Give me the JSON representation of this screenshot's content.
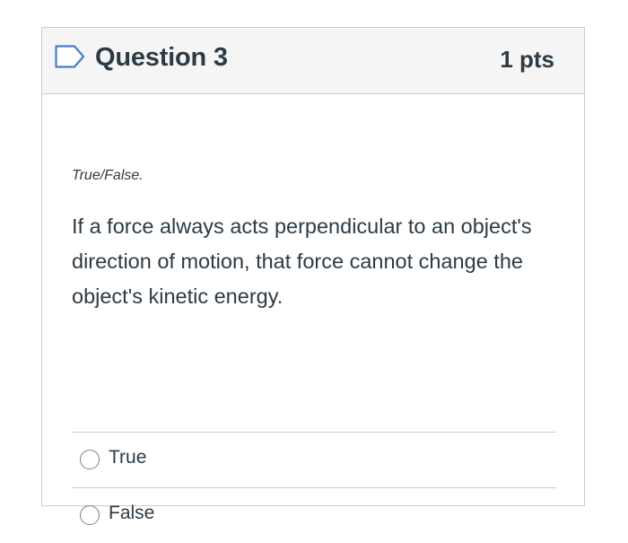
{
  "question": {
    "title": "Question 3",
    "points": "1 pts",
    "flag_icon": "bookmark-flag-icon",
    "type_label": "True/False.",
    "text": "If a force always acts perpendicular to an object's direction of motion, that force cannot change the object's kinetic energy.",
    "answers": [
      {
        "label": "True",
        "selected": false
      },
      {
        "label": "False",
        "selected": false
      }
    ]
  },
  "colors": {
    "header_bg": "#f5f5f5",
    "border": "#c7cdd1",
    "text": "#2d3b45",
    "flag": "#4a7cc6",
    "radio_border": "#73818a"
  }
}
